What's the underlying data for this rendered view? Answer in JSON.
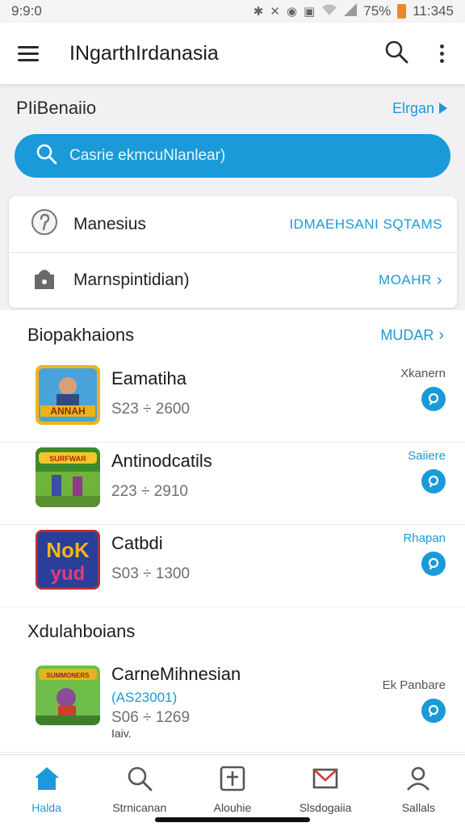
{
  "status": {
    "time_left": "9:9:0",
    "battery": "75%",
    "clock": "11:345"
  },
  "app_bar": {
    "title": "INgarthIrdanasia"
  },
  "section": {
    "title": "PIiBenaiio",
    "link": "Elrgan"
  },
  "search": {
    "placeholder": "Casrie ekmcuNlanlear)"
  },
  "card": {
    "row1": {
      "label": "Manesius",
      "action": "IDMAEHSANI SQTAMS"
    },
    "row2": {
      "label": "Marnspintidian)",
      "action": "MOAHR"
    }
  },
  "list": {
    "title": "Biopakhaions",
    "more": "MUDAR",
    "items": [
      {
        "name": "Eamatiha",
        "price": "S23 ÷ 2600",
        "side": "Xkanern"
      },
      {
        "name": "Antinodcatils",
        "price": "223 ÷ 2910",
        "side": "Saiiere"
      },
      {
        "name": "Catbdi",
        "price": "S03 ÷ 1300",
        "side": "Rhapan"
      }
    ],
    "subtitle": "Xdulahboians",
    "featured": {
      "name": "CarneMihnesian",
      "extra": "(AS23001)",
      "price": "S06 ÷ 1269",
      "small": "Iaiv.",
      "side": "Ek Panbare"
    }
  },
  "nav": {
    "items": [
      {
        "label": "Halda"
      },
      {
        "label": "Strnicanan"
      },
      {
        "label": "Alouhie"
      },
      {
        "label": "Slsdogaiia"
      },
      {
        "label": "Sallals"
      }
    ]
  },
  "colors": {
    "accent": "#1a9ad9",
    "battery": "#e8892b"
  }
}
